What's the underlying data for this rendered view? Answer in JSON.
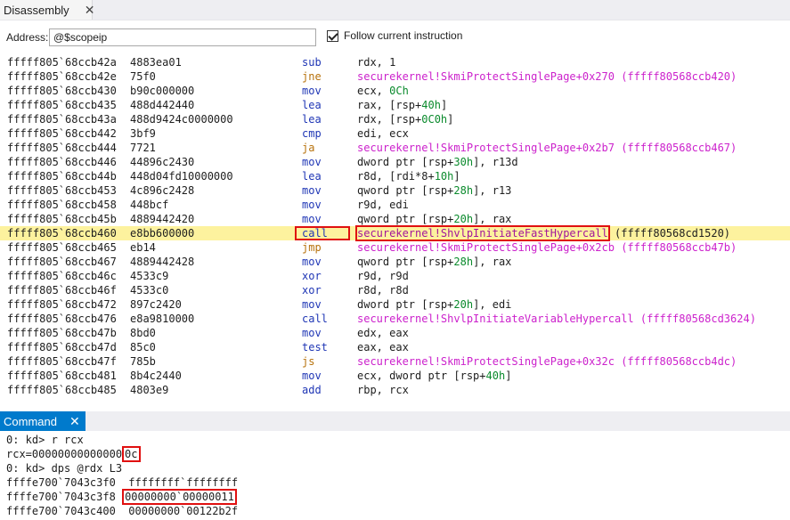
{
  "disassembly_tab": {
    "title": "Disassembly",
    "close": "✕"
  },
  "address": {
    "label": "Address:",
    "value": "@$scopeip",
    "follow_label": "Follow current instruction",
    "follow_checked": true
  },
  "lines": [
    {
      "addr": "fffff805`68ccb42a",
      "bytes": "4883ea01",
      "mn": "sub",
      "ops": "rdx, 1"
    },
    {
      "addr": "fffff805`68ccb42e",
      "bytes": "75f0",
      "mn": "jne",
      "ops": "securekernel!SkmiProtectSinglePage+0x270 (fffff80568ccb420)"
    },
    {
      "addr": "fffff805`68ccb430",
      "bytes": "b90c000000",
      "mn": "mov",
      "ops": "ecx, 0Ch"
    },
    {
      "addr": "fffff805`68ccb435",
      "bytes": "488d442440",
      "mn": "lea",
      "ops": "rax, [rsp+40h]"
    },
    {
      "addr": "fffff805`68ccb43a",
      "bytes": "488d9424c0000000",
      "mn": "lea",
      "ops": "rdx, [rsp+0C0h]"
    },
    {
      "addr": "fffff805`68ccb442",
      "bytes": "3bf9",
      "mn": "cmp",
      "ops": "edi, ecx"
    },
    {
      "addr": "fffff805`68ccb444",
      "bytes": "7721",
      "mn": "ja",
      "ops": "securekernel!SkmiProtectSinglePage+0x2b7 (fffff80568ccb467)"
    },
    {
      "addr": "fffff805`68ccb446",
      "bytes": "44896c2430",
      "mn": "mov",
      "ops": "dword ptr [rsp+30h], r13d"
    },
    {
      "addr": "fffff805`68ccb44b",
      "bytes": "448d04fd10000000",
      "mn": "lea",
      "ops": "r8d, [rdi*8+10h]"
    },
    {
      "addr": "fffff805`68ccb453",
      "bytes": "4c896c2428",
      "mn": "mov",
      "ops": "qword ptr [rsp+28h], r13"
    },
    {
      "addr": "fffff805`68ccb458",
      "bytes": "448bcf",
      "mn": "mov",
      "ops": "r9d, edi"
    },
    {
      "addr": "fffff805`68ccb45b",
      "bytes": "4889442420",
      "mn": "mov",
      "ops": "qword ptr [rsp+20h], rax"
    },
    {
      "addr": "fffff805`68ccb460",
      "bytes": "e8bb600000",
      "mn": "call",
      "ops_sym": "securekernel!ShvlpInitiateFastHypercall",
      "ops_tail": " (fffff80568cd1520)"
    },
    {
      "addr": "fffff805`68ccb465",
      "bytes": "eb14",
      "mn": "jmp",
      "ops": "securekernel!SkmiProtectSinglePage+0x2cb (fffff80568ccb47b)"
    },
    {
      "addr": "fffff805`68ccb467",
      "bytes": "4889442428",
      "mn": "mov",
      "ops": "qword ptr [rsp+28h], rax"
    },
    {
      "addr": "fffff805`68ccb46c",
      "bytes": "4533c9",
      "mn": "xor",
      "ops": "r9d, r9d"
    },
    {
      "addr": "fffff805`68ccb46f",
      "bytes": "4533c0",
      "mn": "xor",
      "ops": "r8d, r8d"
    },
    {
      "addr": "fffff805`68ccb472",
      "bytes": "897c2420",
      "mn": "mov",
      "ops": "dword ptr [rsp+20h], edi"
    },
    {
      "addr": "fffff805`68ccb476",
      "bytes": "e8a9810000",
      "mn": "call",
      "ops": "securekernel!ShvlpInitiateVariableHypercall (fffff80568cd3624)"
    },
    {
      "addr": "fffff805`68ccb47b",
      "bytes": "8bd0",
      "mn": "mov",
      "ops": "edx, eax"
    },
    {
      "addr": "fffff805`68ccb47d",
      "bytes": "85c0",
      "mn": "test",
      "ops": "eax, eax"
    },
    {
      "addr": "fffff805`68ccb47f",
      "bytes": "785b",
      "mn": "js",
      "ops": "securekernel!SkmiProtectSinglePage+0x32c (fffff80568ccb4dc)"
    },
    {
      "addr": "fffff805`68ccb481",
      "bytes": "8b4c2440",
      "mn": "mov",
      "ops": "ecx, dword ptr [rsp+40h]"
    },
    {
      "addr": "fffff805`68ccb485",
      "bytes": "4803e9",
      "mn": "add",
      "ops": "rbp, rcx"
    }
  ],
  "command_tab": {
    "title": "Command",
    "close": "✕"
  },
  "command": {
    "l1": "0: kd> r rcx",
    "l2_pre": "rcx=00000000000000",
    "l2_box": "0c",
    "l3": "0: kd> dps @rdx L3",
    "r1_addr": "ffffe700`7043c3f0",
    "r1_val": "ffffffff`ffffffff",
    "r2_addr": "ffffe700`7043c3f8",
    "r2_val": "00000000`00000011",
    "r3_addr": "ffffe700`7043c400",
    "r3_val": "00000000`00122b2f"
  },
  "colors": {
    "mnemonic": "#1f36b5",
    "jump": "#b7720c",
    "symbol": "#cc22cc",
    "highlight": "#fdf29e",
    "annotation_box": "#e01010",
    "command_tab": "#007acc"
  }
}
